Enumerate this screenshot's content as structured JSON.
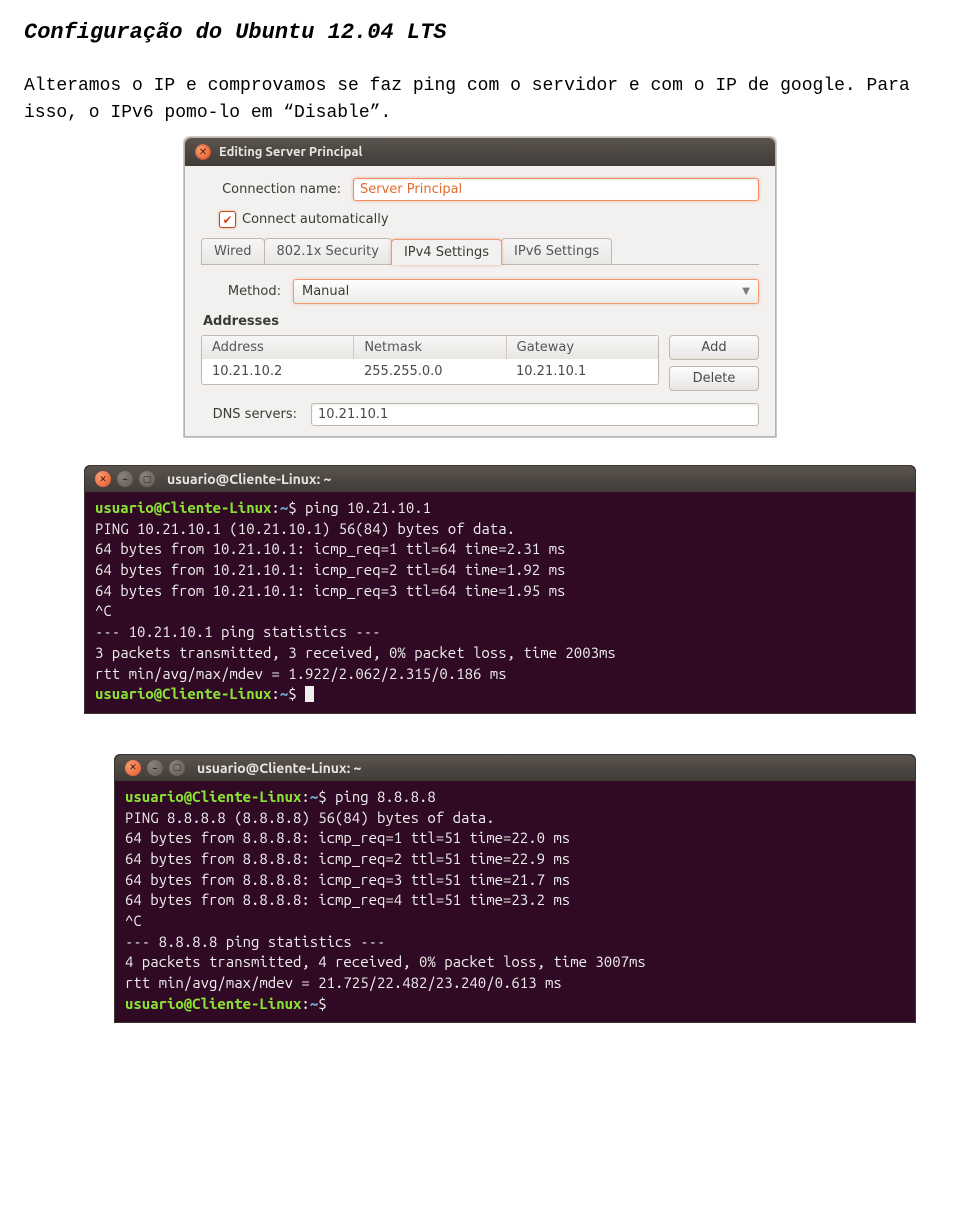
{
  "doc": {
    "title": "Configuração do Ubuntu 12.04 LTS",
    "paragraph": "Alteramos o IP e comprovamos se faz ping com o servidor e com o IP de google. Para isso, o IPv6 pomo-lo em “Disable”."
  },
  "nm": {
    "window_title": "Editing Server Principal",
    "conn_label": "Connection name:",
    "conn_value": "Server Principal",
    "auto_label": "Connect automatically",
    "auto_checked": true,
    "tabs": [
      "Wired",
      "802.1x Security",
      "IPv4 Settings",
      "IPv6 Settings"
    ],
    "active_tab_index": 2,
    "method_label": "Method:",
    "method_value": "Manual",
    "addresses_label": "Addresses",
    "columns": [
      "Address",
      "Netmask",
      "Gateway"
    ],
    "row": {
      "address": "10.21.10.2",
      "netmask": "255.255.0.0",
      "gateway": "10.21.10.1"
    },
    "buttons": {
      "add": "Add",
      "delete": "Delete"
    },
    "dns_label": "DNS servers:",
    "dns_value": "10.21.10.1"
  },
  "terminal1": {
    "title": "usuario@Cliente-Linux: ~",
    "prompt_user": "usuario@Cliente-Linux",
    "prompt_path": "~",
    "cmd": "ping 10.21.10.1",
    "lines": [
      "PING 10.21.10.1 (10.21.10.1) 56(84) bytes of data.",
      "64 bytes from 10.21.10.1: icmp_req=1 ttl=64 time=2.31 ms",
      "64 bytes from 10.21.10.1: icmp_req=2 ttl=64 time=1.92 ms",
      "64 bytes from 10.21.10.1: icmp_req=3 ttl=64 time=1.95 ms",
      "^C",
      "--- 10.21.10.1 ping statistics ---",
      "3 packets transmitted, 3 received, 0% packet loss, time 2003ms",
      "rtt min/avg/max/mdev = 1.922/2.062/2.315/0.186 ms"
    ]
  },
  "terminal2": {
    "title": "usuario@Cliente-Linux: ~",
    "prompt_user": "usuario@Cliente-Linux",
    "prompt_path": "~",
    "cmd": "ping 8.8.8.8",
    "lines": [
      "PING 8.8.8.8 (8.8.8.8) 56(84) bytes of data.",
      "64 bytes from 8.8.8.8: icmp_req=1 ttl=51 time=22.0 ms",
      "64 bytes from 8.8.8.8: icmp_req=2 ttl=51 time=22.9 ms",
      "64 bytes from 8.8.8.8: icmp_req=3 ttl=51 time=21.7 ms",
      "64 bytes from 8.8.8.8: icmp_req=4 ttl=51 time=23.2 ms",
      "^C",
      "--- 8.8.8.8 ping statistics ---",
      "4 packets transmitted, 4 received, 0% packet loss, time 3007ms",
      "rtt min/avg/max/mdev = 21.725/22.482/23.240/0.613 ms"
    ]
  }
}
